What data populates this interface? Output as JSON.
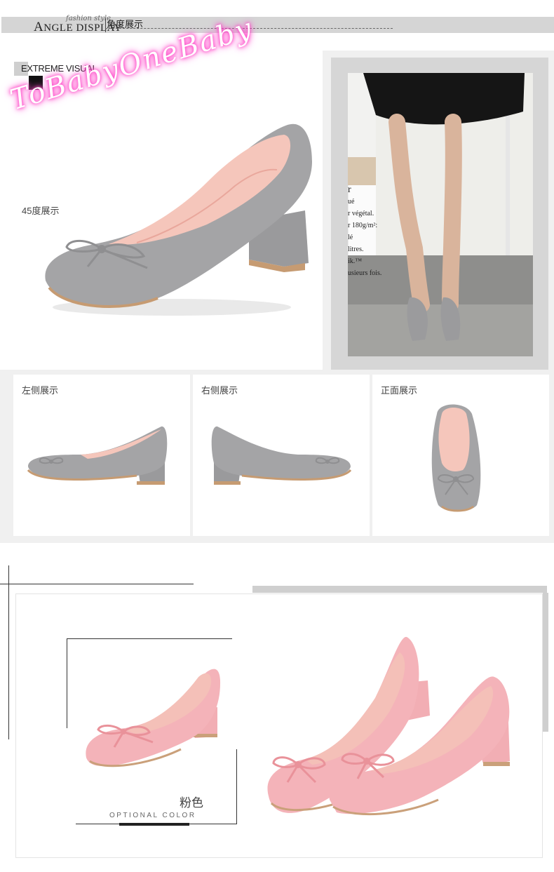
{
  "header": {
    "script_text": "fashion style",
    "title_first_letter": "A",
    "title_rest": "NGLE DISPLAY",
    "title_cn": "角度展示"
  },
  "watermark": {
    "text": "ToBabyOneBaby",
    "color": "#ff3fc5"
  },
  "section_angle": {
    "extreme_visual_label": "EXTREME VISUAL",
    "main_view_label": "45度展示",
    "views": [
      {
        "label": "左侧展示"
      },
      {
        "label": "右侧展示"
      },
      {
        "label": "正面展示"
      }
    ],
    "photo_sign_lines": [
      "r",
      "ué",
      "r végétal.",
      "r 180g/m²:",
      "lé",
      "litres.",
      "ik.™",
      "usieurs fois."
    ]
  },
  "section_color": {
    "color_name": "粉色",
    "color_label_en": "OPTIONAL COLOR"
  },
  "colors": {
    "shoe_gray": "#a3a3a5",
    "shoe_pink": "#f4b3b9",
    "lining_pink": "#f4c0b8",
    "heel_brown": "#caa07a"
  }
}
